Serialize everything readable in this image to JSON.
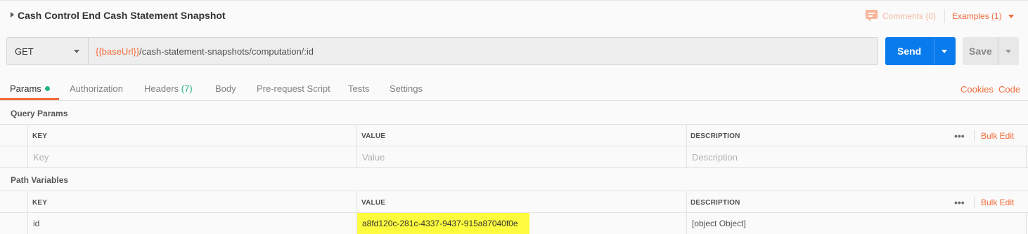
{
  "request": {
    "title": "Cash Control End Cash Statement Snapshot",
    "comments_label": "Comments (0)",
    "examples_label": "Examples (1)"
  },
  "url_bar": {
    "method": "GET",
    "url_variable": "{{baseUrl}}",
    "url_path": "/cash-statement-snapshots/computation/:id",
    "send_label": "Send",
    "save_label": "Save"
  },
  "tabs": {
    "params": "Params",
    "authorization": "Authorization",
    "headers": "Headers",
    "headers_count": "(7)",
    "body": "Body",
    "prerequest": "Pre-request Script",
    "tests": "Tests",
    "settings": "Settings",
    "cookies": "Cookies",
    "code": "Code"
  },
  "query_params": {
    "section_label": "Query Params",
    "columns": {
      "key": "KEY",
      "value": "VALUE",
      "description": "DESCRIPTION"
    },
    "bulk_edit": "Bulk Edit",
    "placeholders": {
      "key": "Key",
      "value": "Value",
      "description": "Description"
    }
  },
  "path_variables": {
    "section_label": "Path Variables",
    "columns": {
      "key": "KEY",
      "value": "VALUE",
      "description": "DESCRIPTION"
    },
    "bulk_edit": "Bulk Edit",
    "rows": [
      {
        "key": "id",
        "value": "a8fd120c-281c-4337-9437-915a87040f0e",
        "description": "[object Object]"
      }
    ]
  },
  "colors": {
    "accent": "#f26b3a",
    "send_button": "#097bed",
    "success_green": "#26b47f",
    "highlight": "#fdfc3e"
  },
  "icons": [
    "caret-right-icon",
    "comment-icon",
    "chevron-down-icon",
    "more-dots-icon"
  ]
}
